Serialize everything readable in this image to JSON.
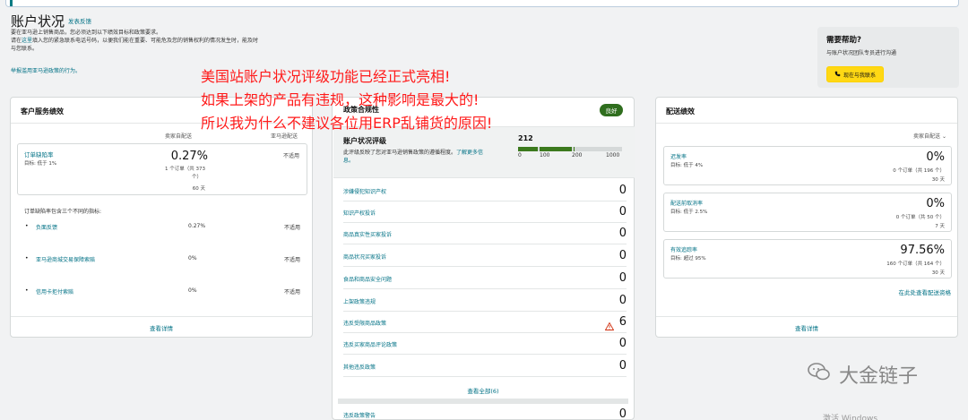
{
  "header": {
    "title": "账户状况",
    "feedback_link": "发表反馈",
    "intro_line1": "要在亚马逊上销售商品，您必须达到以下绩效目标和政策要求。",
    "intro_line2_prefix": "请在",
    "intro_line2_link": "这里",
    "intro_line2_suffix": "填入您的紧急联系电话号码，以便我们能在重要、可能危及您的销售权利的情况发生时，能及时",
    "intro_line3": "与您联系。",
    "report_link": "举报滥用亚马逊政策的行为。"
  },
  "help": {
    "title": "需要帮助?",
    "subtitle": "与账户状况团队专员进行沟通",
    "button_label": "现在与我联系"
  },
  "overlay": {
    "line1": "美国站账户状况评级功能已经正式亮相!",
    "line2": "如果上架的产品有违规，这种影响是最大的!",
    "line3": "所以我为什么不建议各位用ERP乱铺货的原因!"
  },
  "customer_service": {
    "title": "客户服务绩效",
    "col_seller": "卖家自配送",
    "col_amazon": "亚马逊配送",
    "odr": {
      "name": "订单缺陷率",
      "target": "目标: 低于 1%",
      "value": "0.27%",
      "detail1": "1 个订单（共 373",
      "detail2": "个）",
      "period": "60 天",
      "amazon_value": "不适用"
    },
    "breakdown_title": "订单缺陷率包含三个不同的指标:",
    "rows": [
      {
        "label": "负面反馈",
        "seller": "0.27%",
        "amazon": "不适用"
      },
      {
        "label": "亚马逊商城交易保障索赔",
        "seller": "0%",
        "amazon": "不适用"
      },
      {
        "label": "信用卡拒付索赔",
        "seller": "0%",
        "amazon": "不适用"
      }
    ],
    "view_details": "查看详情"
  },
  "policy": {
    "title": "政策合规性",
    "badge": "良好",
    "status_title": "账户状况评级",
    "status_desc": "此评级反映了您对亚马逊销售政策的遵循程度。",
    "status_more": "了解更多信息。",
    "score": "212",
    "ticks": [
      "0",
      "100",
      "200",
      "1000"
    ],
    "rows": [
      {
        "label": "涉嫌侵犯知识产权",
        "value": "0"
      },
      {
        "label": "知识产权投诉",
        "value": "0"
      },
      {
        "label": "商品真实性买家投诉",
        "value": "0"
      },
      {
        "label": "商品状况买家投诉",
        "value": "0"
      },
      {
        "label": "食品和商品安全问题",
        "value": "0"
      },
      {
        "label": "上架政策违规",
        "value": "0"
      },
      {
        "label": "违反受限商品政策",
        "value": "6"
      },
      {
        "label": "违反买家商品评论政策",
        "value": "0"
      },
      {
        "label": "其他违反政策",
        "value": "0"
      }
    ],
    "view_all": "查看全部(6)",
    "warnings_label": "违反政策警告",
    "warnings_value": "0"
  },
  "shipping": {
    "title": "配送绩效",
    "subtitle": "卖家自配送",
    "metrics": [
      {
        "name": "迟发率",
        "target": "目标: 低于 4%",
        "value": "0%",
        "detail": "0 个订单（共 196 个）",
        "period": "30 天"
      },
      {
        "name": "配送前取消率",
        "target": "目标: 低于 2.5%",
        "value": "0%",
        "detail": "0 个订单（共 50 个）",
        "period": "7 天"
      },
      {
        "name": "有效追踪率",
        "target": "目标: 超过 95%",
        "value": "97.56%",
        "detail": "160 个订单（共 164 个）",
        "period": "30 天"
      }
    ],
    "eligibility_link": "在此处查看配送资格",
    "view_details": "查看详情"
  },
  "watermark": {
    "text": "大金链子"
  },
  "os_watermark": "激活 Windows"
}
